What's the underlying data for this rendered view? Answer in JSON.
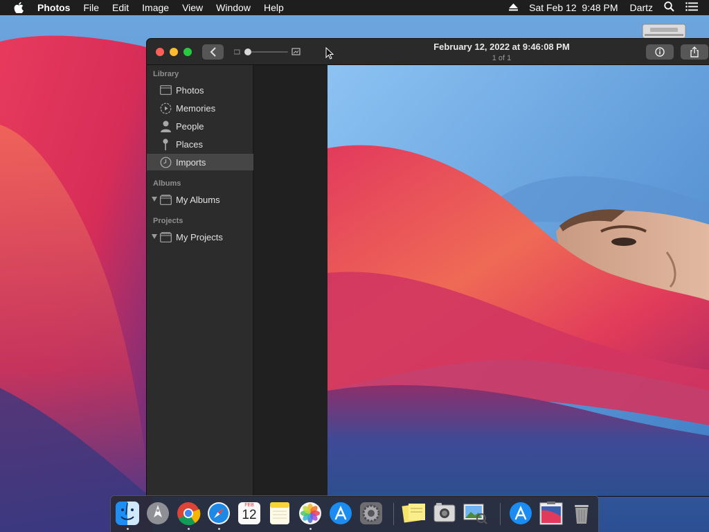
{
  "menubar": {
    "app_name": "Photos",
    "menus": [
      "File",
      "Edit",
      "Image",
      "View",
      "Window",
      "Help"
    ],
    "clock": "Sat Feb 12  9:48 PM",
    "user": "Dartz"
  },
  "window": {
    "title": "February 12, 2022 at 9:46:08 PM",
    "subtitle": "1 of 1"
  },
  "sidebar": {
    "library_heading": "Library",
    "library_items": [
      "Photos",
      "Memories",
      "People",
      "Places",
      "Imports"
    ],
    "selected_item": "Imports",
    "albums_heading": "Albums",
    "albums_item": "My Albums",
    "projects_heading": "Projects",
    "projects_item": "My Projects"
  },
  "calendar_icon": {
    "month": "FEB",
    "day": "12"
  },
  "dock": {
    "apps": [
      "Finder",
      "Launchpad",
      "Google Chrome",
      "Safari",
      "Calendar",
      "Notes",
      "Photos",
      "App Store",
      "System Preferences",
      "Stickies",
      "Screenshot",
      "Preview",
      "App Store",
      "Desktop Picture",
      "Trash"
    ],
    "running": [
      "Finder",
      "Google Chrome",
      "Safari",
      "Photos"
    ]
  },
  "colors": {
    "menubar_bg": "#1e1e1e",
    "sidebar_bg": "#2c2c2c",
    "selected_row": "#464646",
    "traffic_close": "#ff5f57",
    "traffic_min": "#febc2e",
    "traffic_max": "#28c840"
  }
}
